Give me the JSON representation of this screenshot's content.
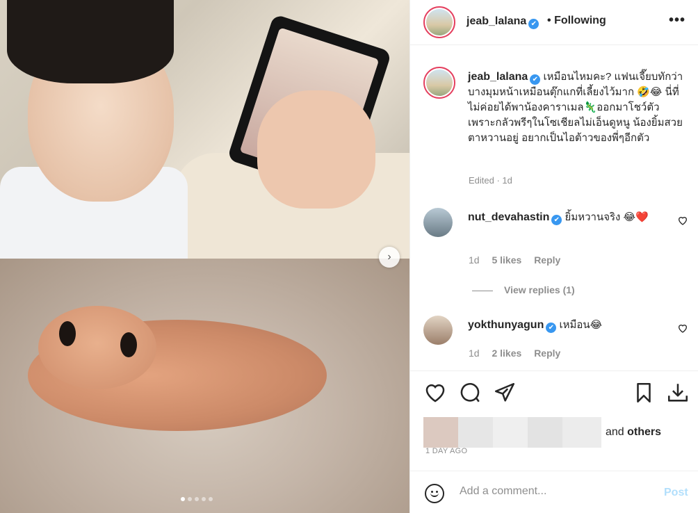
{
  "post": {
    "username": "jeab_lalana",
    "verified_mark": "✔",
    "separator": "•",
    "following_label": "Following",
    "more_label": "•••",
    "caption": "เหมือนไหมคะ? แฟนเจี๊ยบทักว่าบางมุมหน้าเหมือนตุ๊กแกที่เลี้ยงไว้มาก 🤣😂 นี่ที่ไม่ค่อยได้พาน้องคาราเมล🦎ออกมาโชว์ตัว เพราะกลัวพรีๆในโซเชียลไม่เอ็นดูหนู น้องยิ้มสวย ตาหวานอยู่ อยากเป็นไอต้าวของพี่ๆอีกตัว",
    "edited": "Edited · 1d",
    "carousel": {
      "total": 5,
      "active": 0
    },
    "next_arrow": "›"
  },
  "comments": [
    {
      "username": "nut_devahastin",
      "text": "ยิ้มหวานจริง 😂❤️",
      "time": "1d",
      "likes": "5 likes",
      "reply": "Reply"
    },
    {
      "username": "yokthunyagun",
      "text": "เหมือน😂",
      "time": "1d",
      "likes": "2 likes",
      "reply": "Reply"
    }
  ],
  "view_replies": "View replies (1)",
  "likes": {
    "and": "and",
    "others": "others"
  },
  "date": "1 DAY AGO",
  "add_comment": {
    "placeholder": "Add a comment...",
    "post_label": "Post"
  },
  "icons": [
    "heart-icon",
    "comment-icon",
    "share-icon",
    "bookmark-icon",
    "download-icon",
    "emoji-icon"
  ],
  "colors": {
    "verified": "#3897f0",
    "post_disabled": "#b2dffc",
    "story_ring": "#e4405f"
  }
}
